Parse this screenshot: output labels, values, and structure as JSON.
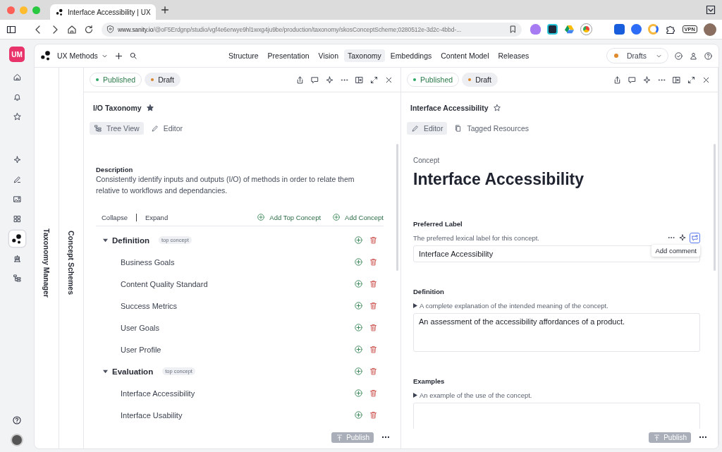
{
  "browser": {
    "tab_title": "Interface Accessibility | UX",
    "url_host": "www.sanity.io",
    "url_path": "/@oF5Erdgnp/studio/vgf4e6erwye9hl1wxg4ju9be/production/taxonomy/skosConceptScheme;0280512e-3d2c-4bbd-...",
    "vpn_label": "VPN"
  },
  "workspace_badge": "UM",
  "rail_nav": [
    {
      "kind": "home"
    },
    {
      "kind": "bell"
    },
    {
      "kind": "star"
    }
  ],
  "rail_tools": [
    {
      "kind": "sparkle",
      "selected": false
    },
    {
      "kind": "pen",
      "selected": false
    },
    {
      "kind": "image",
      "selected": false
    },
    {
      "kind": "grid",
      "selected": false
    },
    {
      "kind": "logo",
      "selected": true
    },
    {
      "kind": "robot",
      "selected": false
    },
    {
      "kind": "tree",
      "selected": false
    }
  ],
  "workspace": "UX Methods",
  "nav_tabs": [
    {
      "label": "Structure",
      "selected": false
    },
    {
      "label": "Presentation",
      "selected": false
    },
    {
      "label": "Vision",
      "selected": false
    },
    {
      "label": "Taxonomy",
      "selected": true
    },
    {
      "label": "Embeddings",
      "selected": false
    },
    {
      "label": "Content Model",
      "selected": false
    },
    {
      "label": "Releases",
      "selected": false
    }
  ],
  "perspective": {
    "label": "Drafts",
    "color": "#e08a2c"
  },
  "columns": [
    {
      "title": "Taxonomy Manager"
    },
    {
      "title": "Concept Schemes"
    }
  ],
  "panes": [
    {
      "kind": "tree",
      "chips": [
        {
          "label": "Published",
          "color": "#2fa866",
          "selected": false
        },
        {
          "label": "Draft",
          "color": "#d9862b",
          "selected": true
        }
      ],
      "title": "I/O Taxonomy",
      "starred": true,
      "view_tabs": [
        {
          "kind": "tree",
          "label": "Tree View",
          "selected": true
        },
        {
          "kind": "edit",
          "label": "Editor",
          "selected": false
        }
      ],
      "description_label": "Description",
      "description": "Consistently identify inputs and outputs (I/O) of methods in order to relate them relative to workflows and dependancies.",
      "collapse": "Collapse",
      "expand": "Expand",
      "add_top_concept": "Add Top Concept",
      "add_concept": "Add Concept",
      "tree": [
        {
          "label": "Definition",
          "badge": "top concept",
          "expanded": true,
          "children": [
            {
              "label": "Business Goals"
            },
            {
              "label": "Content Quality Standard"
            },
            {
              "label": "Success Metrics"
            },
            {
              "label": "User Goals"
            },
            {
              "label": "User Profile"
            }
          ]
        },
        {
          "label": "Evaluation",
          "badge": "top concept",
          "expanded": true,
          "children": [
            {
              "label": "Interface Accessibility"
            },
            {
              "label": "Interface Usability"
            }
          ]
        }
      ],
      "publish": {
        "label": "Publish",
        "disabled": true
      }
    },
    {
      "kind": "editor",
      "chips": [
        {
          "label": "Published",
          "color": "#2fa866",
          "selected": false
        },
        {
          "label": "Draft",
          "color": "#d9862b",
          "selected": true
        }
      ],
      "title": "Interface Accessibility",
      "starred": false,
      "view_tabs": [
        {
          "kind": "edit",
          "label": "Editor",
          "selected": true
        },
        {
          "kind": "document",
          "label": "Tagged Resources",
          "selected": false
        }
      ],
      "type_label": "Concept",
      "heading": "Interface Accessibility",
      "fields": [
        {
          "kind": "input",
          "label": "Preferred Label",
          "description": "The preferred lexical label for this concept.",
          "disclosure": false,
          "value": "Interface Accessibility",
          "tooltip": "Add comment"
        },
        {
          "kind": "textarea",
          "label": "Definition",
          "description": "A complete explanation of the intended meaning of the concept.",
          "disclosure": true,
          "value": "An assessment of the accessibility affordances of a product."
        },
        {
          "kind": "textarea",
          "label": "Examples",
          "description": "An example of the use of the concept.",
          "disclosure": true
        }
      ],
      "publish": {
        "label": "Publish",
        "disabled": true
      }
    }
  ]
}
